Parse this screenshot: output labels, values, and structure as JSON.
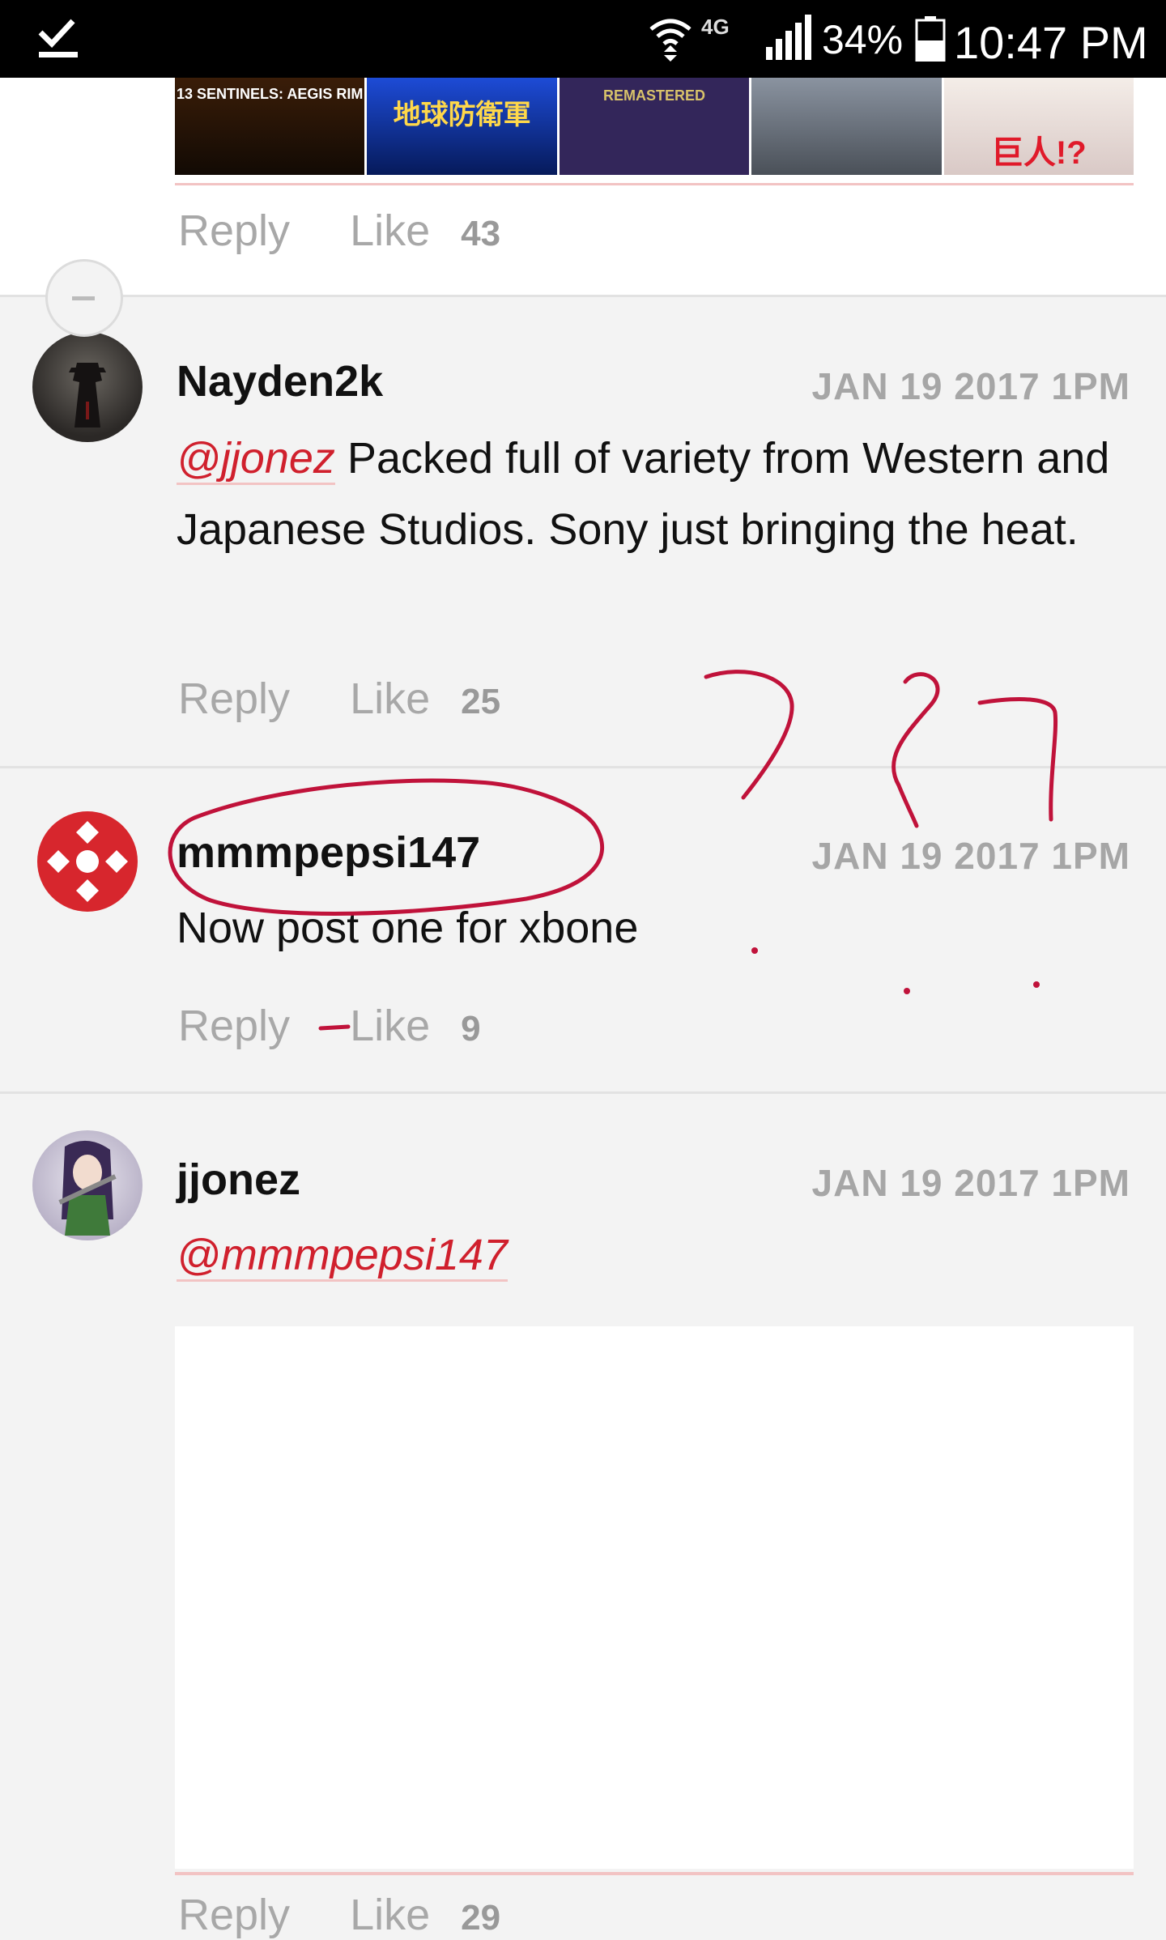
{
  "status_bar": {
    "network": "4G",
    "battery": "34%",
    "time": "10:47 PM"
  },
  "previous_comment": {
    "thumbnails": [
      {
        "caption": "13 SENTINELS: AEGIS RIM",
        "color": "#2a1608"
      },
      {
        "caption": "地球防衛軍",
        "color": "#0b2a8a"
      },
      {
        "caption": "REMASTERED",
        "color": "#33265a"
      },
      {
        "caption": "",
        "color": "#6f7680"
      },
      {
        "caption": "巨人!?",
        "color": "#e8e0dc"
      }
    ],
    "reply_label": "Reply",
    "like_label": "Like",
    "like_count": "43"
  },
  "comments": [
    {
      "username": "Nayden2k",
      "date": "JAN 19 2017 1PM",
      "mention": "@jjonez",
      "text": " Packed full of variety from Western and Japanese Studios. Sony just bringing the heat.",
      "reply_label": "Reply",
      "like_label": "Like",
      "like_count": "25"
    },
    {
      "username": "mmmpepsi147",
      "date": "JAN 19 2017 1PM",
      "text": "Now post one for xbone",
      "reply_label": "Reply",
      "like_label": "Like",
      "like_count": "9"
    },
    {
      "username": "jjonez",
      "date": "JAN 19 2017 1PM",
      "mention": "@mmmpepsi147",
      "reply_label": "Reply",
      "like_label": "Like",
      "like_count": "29"
    }
  ],
  "colors": {
    "mention": "#d0202d",
    "annotation": "#c0123a"
  }
}
